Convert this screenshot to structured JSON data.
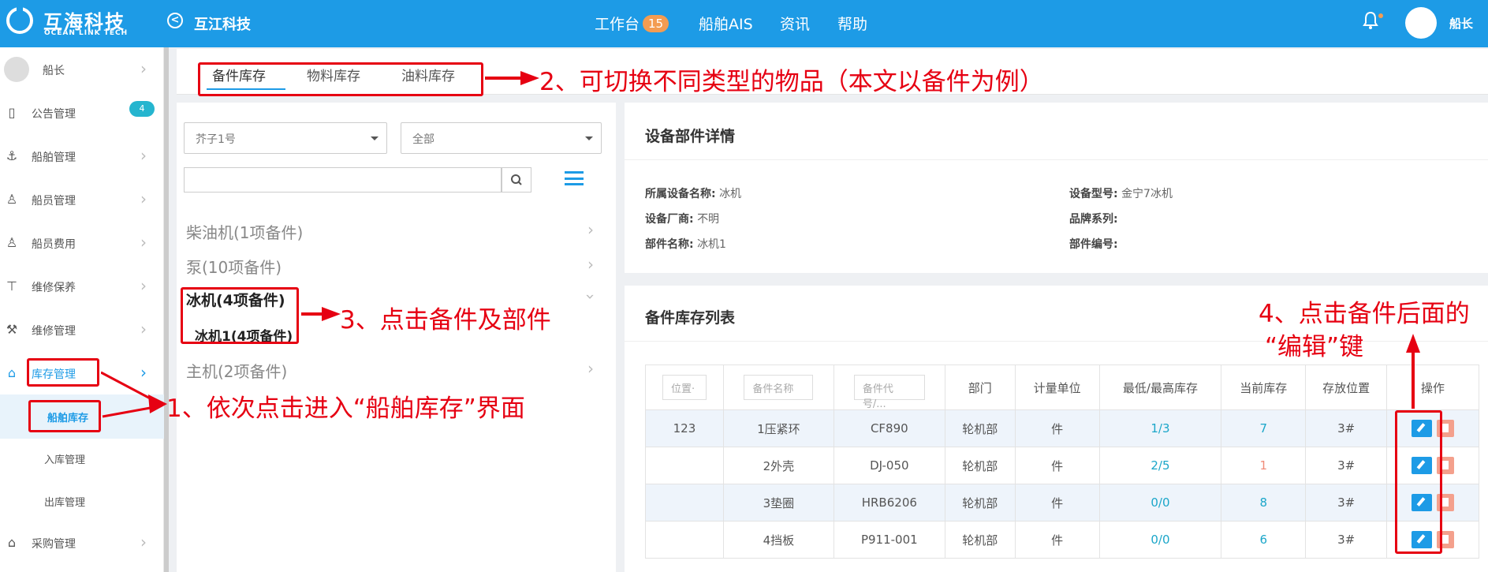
{
  "topbar": {
    "brand_name": "互海科技",
    "brand_sub": "OCEAN LINK TECH",
    "company": "互江科技",
    "nav": [
      {
        "label": "工作台",
        "badge": "15"
      },
      {
        "label": "船舶AIS"
      },
      {
        "label": "资讯"
      },
      {
        "label": "帮助"
      }
    ],
    "user_name": "船长"
  },
  "sidebar": {
    "user": "船长",
    "items": [
      {
        "label": "公告管理",
        "icon": "book-icon",
        "badge": "4"
      },
      {
        "label": "船舶管理",
        "icon": "anchor-icon"
      },
      {
        "label": "船员管理",
        "icon": "person-icon"
      },
      {
        "label": "船员费用",
        "icon": "person-icon"
      },
      {
        "label": "维修保养",
        "icon": "hammer-icon"
      },
      {
        "label": "维修管理",
        "icon": "wrench-icon"
      },
      {
        "label": "库存管理",
        "icon": "basket-icon"
      },
      {
        "label": "船舶库存"
      },
      {
        "label": "入库管理"
      },
      {
        "label": "出库管理"
      },
      {
        "label": "采购管理",
        "icon": "basket-icon"
      }
    ]
  },
  "tabs": [
    "备件库存",
    "物料库存",
    "油料库存"
  ],
  "filters": {
    "ship_select": "芥子1号",
    "type_select": "全部"
  },
  "tree": [
    "柴油机(1项备件)",
    "泵(10项备件)",
    "冰机(4项备件)",
    "冰机1(4项备件)",
    "主机(2项备件)"
  ],
  "detail": {
    "title": "设备部件详情",
    "fields": [
      {
        "label": "所属设备名称:",
        "value": "冰机"
      },
      {
        "label": "设备型号:",
        "value": "金宁7冰机"
      },
      {
        "label": "设备厂商:",
        "value": "不明"
      },
      {
        "label": "品牌系列:",
        "value": ""
      },
      {
        "label": "部件名称:",
        "value": "冰机1"
      },
      {
        "label": "部件编号:",
        "value": ""
      }
    ]
  },
  "list": {
    "title": "备件库存列表",
    "filter_placeholders": [
      "位置·",
      "备件名称",
      "备件代号/..."
    ],
    "headers": [
      "部门",
      "计量单位",
      "最低/最高库存",
      "当前库存",
      "存放位置",
      "操作"
    ],
    "rows": [
      {
        "pos": "123",
        "name": "1压紧环",
        "code": "CF890",
        "dept": "轮机部",
        "unit": "件",
        "minmax": "1/3",
        "current": "7",
        "current_status": "ok",
        "location": "3#"
      },
      {
        "pos": "",
        "name": "2外壳",
        "code": "DJ-050",
        "dept": "轮机部",
        "unit": "件",
        "minmax": "2/5",
        "current": "1",
        "current_status": "low",
        "location": "3#"
      },
      {
        "pos": "",
        "name": "3垫圈",
        "code": "HRB6206",
        "dept": "轮机部",
        "unit": "件",
        "minmax": "0/0",
        "current": "8",
        "current_status": "ok",
        "location": "3#"
      },
      {
        "pos": "",
        "name": "4挡板",
        "code": "P911-001",
        "dept": "轮机部",
        "unit": "件",
        "minmax": "0/0",
        "current": "6",
        "current_status": "ok",
        "location": "3#"
      }
    ]
  },
  "annotations": {
    "a1": "1、依次点击进入“船舶库存”界面",
    "a2": "2、可切换不同类型的物品（本文以备件为例）",
    "a3": "3、点击备件及部件",
    "a4_line1": "4、点击备件后面的",
    "a4_line2": "“编辑”键"
  },
  "colors": {
    "primary": "#1d9be6",
    "annotation": "#e60012",
    "badge": "#f39c52"
  }
}
